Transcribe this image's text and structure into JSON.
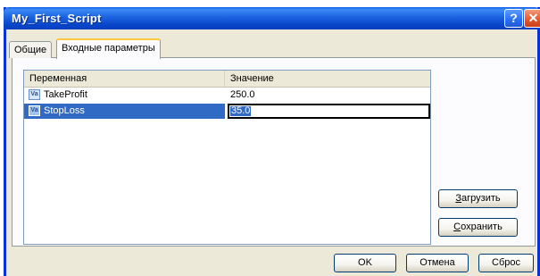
{
  "window": {
    "title": "My_First_Script",
    "help_glyph": "?",
    "close_glyph": "✕"
  },
  "tabs": [
    {
      "label": "Общие",
      "active": false
    },
    {
      "label": "Входные параметры",
      "active": true
    }
  ],
  "grid": {
    "columns": [
      "Переменная",
      "Значение"
    ],
    "rows": [
      {
        "icon": "variable-icon",
        "icon_text": "Va",
        "name": "TakeProfit",
        "value": "250.0",
        "selected": false
      },
      {
        "icon": "variable-icon",
        "icon_text": "Va",
        "name": "StopLoss",
        "value": "35.0",
        "selected": true
      }
    ]
  },
  "buttons": {
    "load_underlined": "З",
    "load_rest": "агрузить",
    "save_underlined": "С",
    "save_rest": "охранить",
    "ok": "OK",
    "cancel": "Отмена",
    "reset": "Сброс"
  },
  "colors": {
    "titlebar": "#0a5de8",
    "selection": "#316ac5",
    "tab_highlight": "#ffc83c"
  }
}
